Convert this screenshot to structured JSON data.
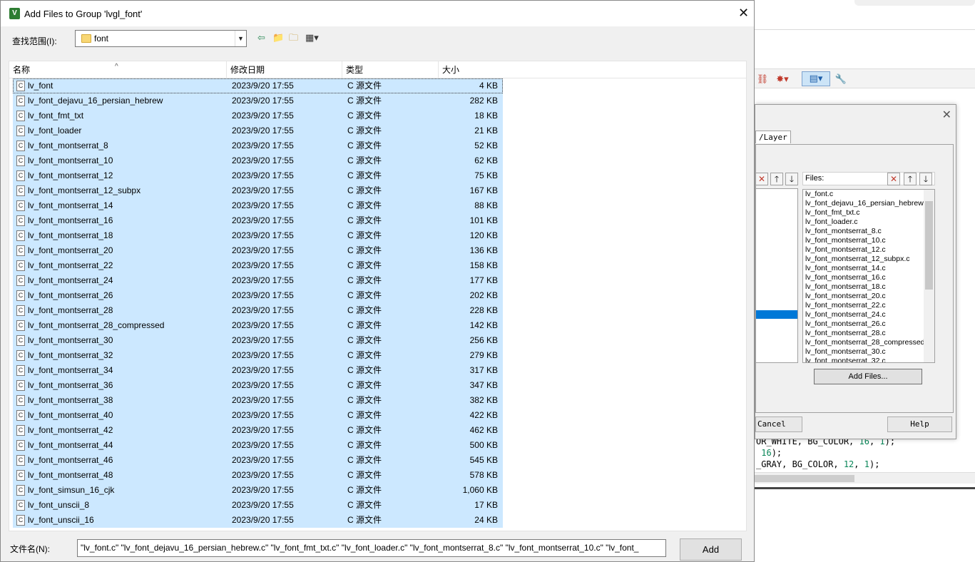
{
  "dialog": {
    "title": "Add Files to Group 'lvgl_font'",
    "look_in_label": "查找范围(I):",
    "look_in_value": "font",
    "file_name_label": "文件名(N):",
    "file_name_value": "\"lv_font.c\" \"lv_font_dejavu_16_persian_hebrew.c\" \"lv_font_fmt_txt.c\" \"lv_font_loader.c\" \"lv_font_montserrat_8.c\" \"lv_font_montserrat_10.c\" \"lv_font_",
    "add_label": "Add",
    "columns": {
      "name": "名称",
      "date": "修改日期",
      "type": "类型",
      "size": "大小"
    },
    "files": [
      {
        "name": "lv_font",
        "date": "2023/9/20 17:55",
        "type": "C 源文件",
        "size": "4 KB"
      },
      {
        "name": "lv_font_dejavu_16_persian_hebrew",
        "date": "2023/9/20 17:55",
        "type": "C 源文件",
        "size": "282 KB"
      },
      {
        "name": "lv_font_fmt_txt",
        "date": "2023/9/20 17:55",
        "type": "C 源文件",
        "size": "18 KB"
      },
      {
        "name": "lv_font_loader",
        "date": "2023/9/20 17:55",
        "type": "C 源文件",
        "size": "21 KB"
      },
      {
        "name": "lv_font_montserrat_8",
        "date": "2023/9/20 17:55",
        "type": "C 源文件",
        "size": "52 KB"
      },
      {
        "name": "lv_font_montserrat_10",
        "date": "2023/9/20 17:55",
        "type": "C 源文件",
        "size": "62 KB"
      },
      {
        "name": "lv_font_montserrat_12",
        "date": "2023/9/20 17:55",
        "type": "C 源文件",
        "size": "75 KB"
      },
      {
        "name": "lv_font_montserrat_12_subpx",
        "date": "2023/9/20 17:55",
        "type": "C 源文件",
        "size": "167 KB"
      },
      {
        "name": "lv_font_montserrat_14",
        "date": "2023/9/20 17:55",
        "type": "C 源文件",
        "size": "88 KB"
      },
      {
        "name": "lv_font_montserrat_16",
        "date": "2023/9/20 17:55",
        "type": "C 源文件",
        "size": "101 KB"
      },
      {
        "name": "lv_font_montserrat_18",
        "date": "2023/9/20 17:55",
        "type": "C 源文件",
        "size": "120 KB"
      },
      {
        "name": "lv_font_montserrat_20",
        "date": "2023/9/20 17:55",
        "type": "C 源文件",
        "size": "136 KB"
      },
      {
        "name": "lv_font_montserrat_22",
        "date": "2023/9/20 17:55",
        "type": "C 源文件",
        "size": "158 KB"
      },
      {
        "name": "lv_font_montserrat_24",
        "date": "2023/9/20 17:55",
        "type": "C 源文件",
        "size": "177 KB"
      },
      {
        "name": "lv_font_montserrat_26",
        "date": "2023/9/20 17:55",
        "type": "C 源文件",
        "size": "202 KB"
      },
      {
        "name": "lv_font_montserrat_28",
        "date": "2023/9/20 17:55",
        "type": "C 源文件",
        "size": "228 KB"
      },
      {
        "name": "lv_font_montserrat_28_compressed",
        "date": "2023/9/20 17:55",
        "type": "C 源文件",
        "size": "142 KB"
      },
      {
        "name": "lv_font_montserrat_30",
        "date": "2023/9/20 17:55",
        "type": "C 源文件",
        "size": "256 KB"
      },
      {
        "name": "lv_font_montserrat_32",
        "date": "2023/9/20 17:55",
        "type": "C 源文件",
        "size": "279 KB"
      },
      {
        "name": "lv_font_montserrat_34",
        "date": "2023/9/20 17:55",
        "type": "C 源文件",
        "size": "317 KB"
      },
      {
        "name": "lv_font_montserrat_36",
        "date": "2023/9/20 17:55",
        "type": "C 源文件",
        "size": "347 KB"
      },
      {
        "name": "lv_font_montserrat_38",
        "date": "2023/9/20 17:55",
        "type": "C 源文件",
        "size": "382 KB"
      },
      {
        "name": "lv_font_montserrat_40",
        "date": "2023/9/20 17:55",
        "type": "C 源文件",
        "size": "422 KB"
      },
      {
        "name": "lv_font_montserrat_42",
        "date": "2023/9/20 17:55",
        "type": "C 源文件",
        "size": "462 KB"
      },
      {
        "name": "lv_font_montserrat_44",
        "date": "2023/9/20 17:55",
        "type": "C 源文件",
        "size": "500 KB"
      },
      {
        "name": "lv_font_montserrat_46",
        "date": "2023/9/20 17:55",
        "type": "C 源文件",
        "size": "545 KB"
      },
      {
        "name": "lv_font_montserrat_48",
        "date": "2023/9/20 17:55",
        "type": "C 源文件",
        "size": "578 KB"
      },
      {
        "name": "lv_font_simsun_16_cjk",
        "date": "2023/9/20 17:55",
        "type": "C 源文件",
        "size": "1,060 KB"
      },
      {
        "name": "lv_font_unscii_8",
        "date": "2023/9/20 17:55",
        "type": "C 源文件",
        "size": "17 KB"
      },
      {
        "name": "lv_font_unscii_16",
        "date": "2023/9/20 17:55",
        "type": "C 源文件",
        "size": "24 KB"
      }
    ],
    "icons": [
      "back-icon",
      "up-folder-icon",
      "new-folder-icon",
      "view-menu-icon",
      "c-file-icon"
    ]
  },
  "manage_dialog": {
    "tab_label": "/Layer",
    "files_label": "Files:",
    "add_files_label": "Add Files...",
    "cancel_label": "Cancel",
    "help_label": "Help",
    "files": [
      "lv_font.c",
      "lv_font_dejavu_16_persian_hebrew",
      "lv_font_fmt_txt.c",
      "lv_font_loader.c",
      "lv_font_montserrat_8.c",
      "lv_font_montserrat_10.c",
      "lv_font_montserrat_12.c",
      "lv_font_montserrat_12_subpx.c",
      "lv_font_montserrat_14.c",
      "lv_font_montserrat_16.c",
      "lv_font_montserrat_18.c",
      "lv_font_montserrat_20.c",
      "lv_font_montserrat_22.c",
      "lv_font_montserrat_24.c",
      "lv_font_montserrat_26.c",
      "lv_font_montserrat_28.c",
      "lv_font_montserrat_28_compressed",
      "lv_font_montserrat_30.c",
      "lv_font_montserrat_32.c"
    ]
  },
  "code": {
    "line1": {
      "a": "OR_WHITE, BG_COLOR, ",
      "n1": "16",
      "b": ", ",
      "n2": "1",
      "c": ");"
    },
    "line2": {
      "a": " ",
      "n1": "16",
      "c": ");"
    },
    "line3": {
      "a": "_GRAY, BG_COLOR, ",
      "n1": "12",
      "b": ", ",
      "n2": "1",
      "c": ");"
    }
  },
  "colors": {
    "selection": "#cce8ff",
    "selection_border": "#99d1ff",
    "accent": "#0078d7"
  }
}
